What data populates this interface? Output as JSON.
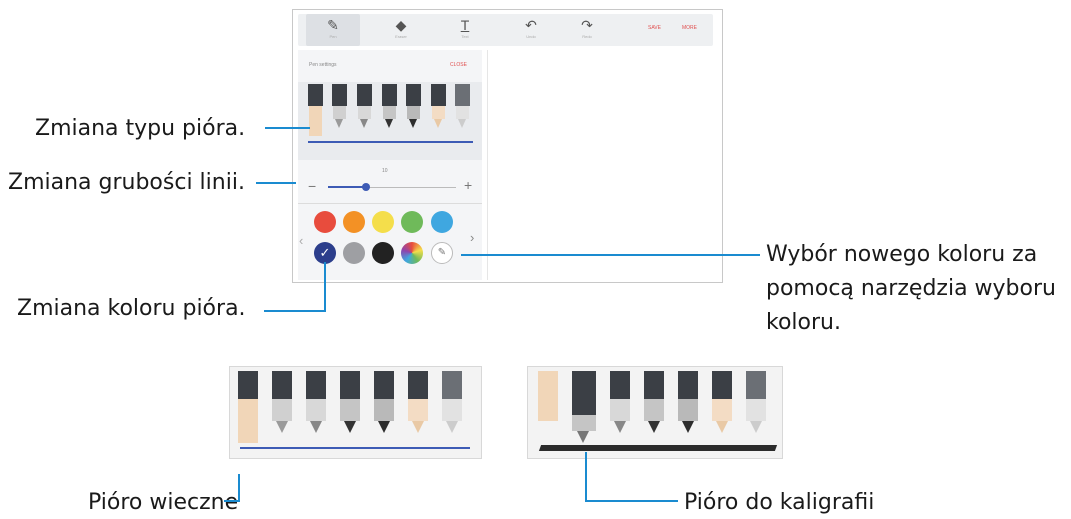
{
  "callouts": {
    "pen_type": "Zmiana typu pióra.",
    "line_thickness": "Zmiana grubości linii.",
    "pen_color": "Zmiana koloru pióra.",
    "new_color_line1": "Wybór nowego koloru za",
    "new_color_line2": "pomocą narzędzia wyboru",
    "new_color_line3": "koloru.",
    "fountain_pen": "Pióro wieczne",
    "calligraphy_pen": "Pióro do kaligrafii"
  },
  "toolbar": {
    "items": [
      {
        "icon": "pen-icon",
        "label": "Pen"
      },
      {
        "icon": "eraser-icon",
        "label": "Eraser"
      },
      {
        "icon": "text-icon",
        "label": "Text"
      },
      {
        "icon": "undo-icon",
        "label": "Undo"
      },
      {
        "icon": "redo-icon",
        "label": "Redo"
      }
    ],
    "save_label": "SAVE",
    "more_label": "MORE"
  },
  "pen_settings": {
    "title": "Pen settings",
    "action": "CLOSE",
    "thickness_value": "10",
    "thickness_level": 0.3,
    "minus": "−",
    "plus": "+"
  },
  "colors": {
    "row1": [
      "#e84c3d",
      "#f39125",
      "#f4de4b",
      "#6fba5a",
      "#3fa7e0"
    ],
    "row2": [
      "#2c3e8c",
      "#9e9fa3",
      "#222222"
    ],
    "selected": "#2c3e8c",
    "accent_line": "#1a8bd0"
  }
}
